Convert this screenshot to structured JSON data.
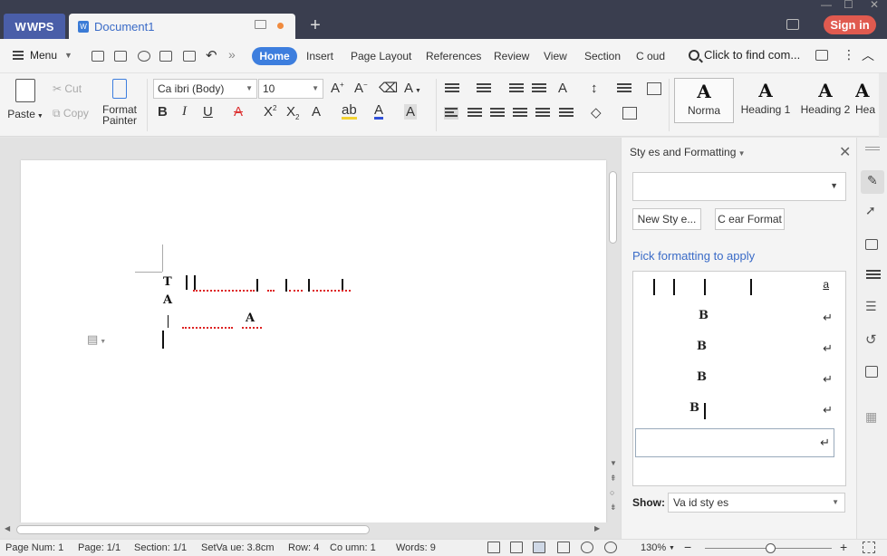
{
  "titlebar": {
    "app_tab": "WPS",
    "doc_tab": "Document1",
    "new_tab": "+",
    "sign_in": "Sign in"
  },
  "menubar": {
    "menu_label": "Menu",
    "overflow": "»",
    "tabs": [
      "Home",
      "Insert",
      "Page Layout",
      "References",
      "Review",
      "View",
      "Section",
      "C oud"
    ],
    "find": "Click to find com..."
  },
  "ribbon": {
    "paste": "Paste",
    "cut": "Cut",
    "copy": "Copy",
    "format_painter_1": "Format",
    "format_painter_2": "Painter",
    "font_name": "Ca ibri (Body)",
    "font_size": "10",
    "bold": "B",
    "italic": "I",
    "underline": "U",
    "styles": [
      {
        "glyph": "A",
        "label": "Norma"
      },
      {
        "glyph": "A",
        "label": "Heading 1"
      },
      {
        "glyph": "A",
        "label": "Heading 2"
      },
      {
        "glyph": "A",
        "label": "Hea"
      }
    ]
  },
  "document": {
    "line2_glyph": "A",
    "line1_glyph": "T",
    "line3_glyph": "A"
  },
  "pane": {
    "title": "Sty es and Formatting",
    "close": "✕",
    "new_style": "New Sty e...",
    "clear_format": "C ear Format",
    "pick_label": "Pick formatting to apply",
    "first_row_char": "a",
    "return_char": "↵",
    "show_label": "Show:",
    "show_value": "Va id sty es"
  },
  "statusbar": {
    "page_num": "Page Num: 1",
    "page": "Page: 1/1",
    "section": "Section: 1/1",
    "setvalue": "SetVa ue: 3.8cm",
    "row": "Row: 4",
    "column": "Co umn: 1",
    "words": "Words: 9",
    "zoom": "130%",
    "zoom_out": "−",
    "zoom_in": "+"
  },
  "colors": {
    "accent": "#3d7ede",
    "signin": "#e05a4f",
    "titlebar": "#3a3e4f"
  }
}
